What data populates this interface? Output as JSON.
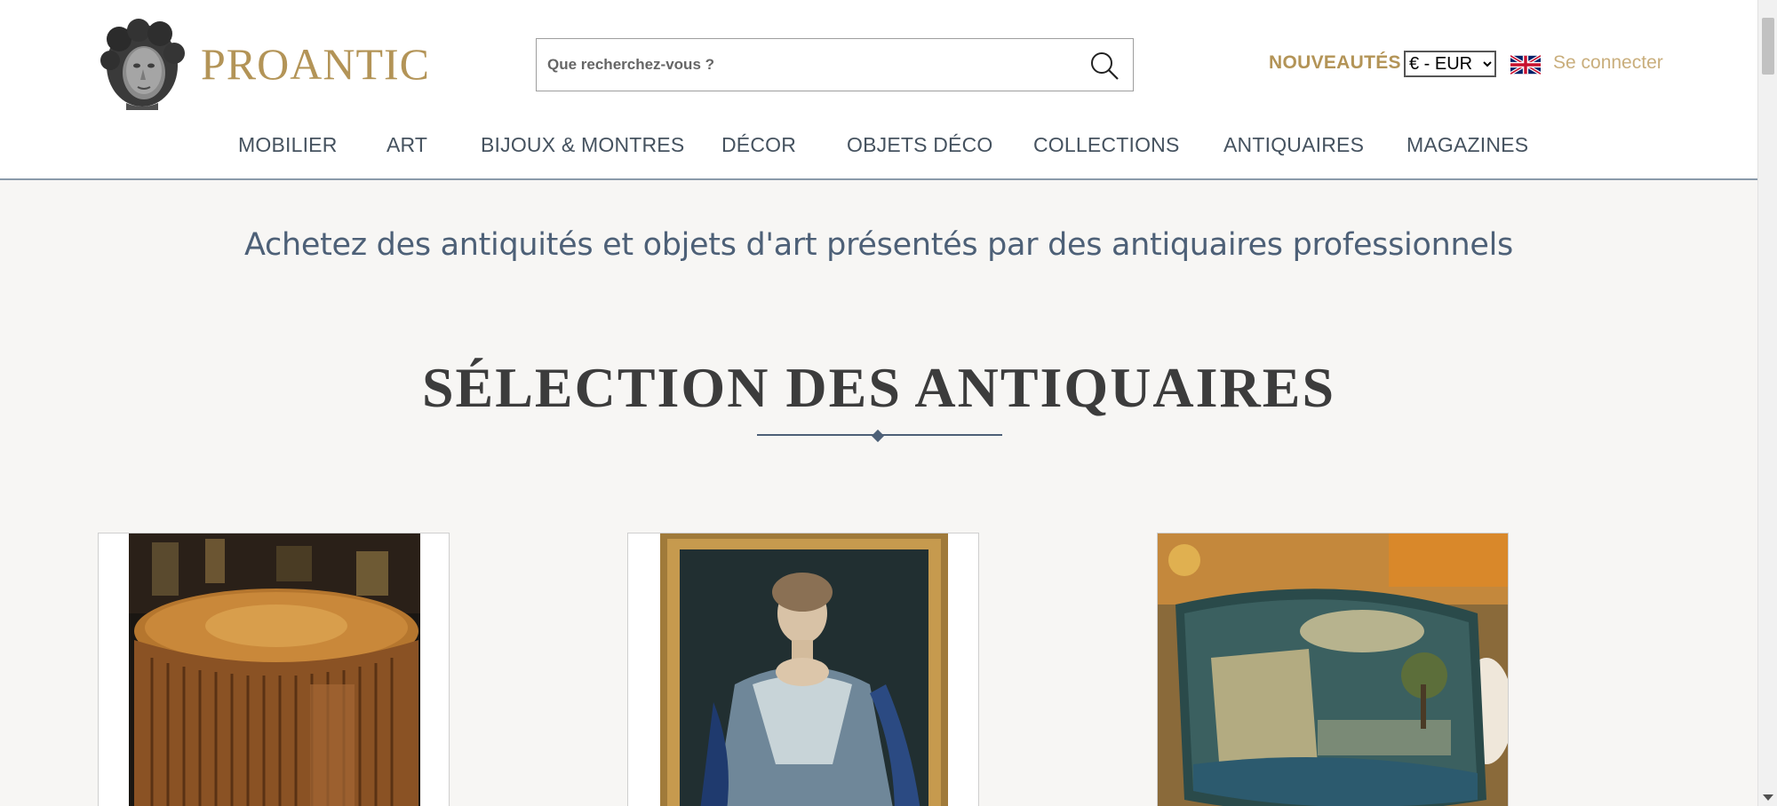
{
  "brand": {
    "name": "PROANTIC"
  },
  "search": {
    "placeholder": "Que recherchez-vous ?"
  },
  "header": {
    "news_label": "NOUVEAUTÉS",
    "currency_selected": "€ - EUR",
    "login_label": "Se connecter"
  },
  "nav": [
    "MOBILIER",
    "ART",
    "BIJOUX & MONTRES",
    "DÉCOR",
    "OBJETS DÉCO",
    "COLLECTIONS",
    "ANTIQUAIRES",
    "MAGAZINES"
  ],
  "hero": {
    "tagline": "Achetez des antiquités et objets d'art présentés par des antiquaires professionnels",
    "section_title": "SÉLECTION DES ANTIQUAIRES"
  },
  "colors": {
    "accent_gold": "#b39457",
    "slate": "#4d6077",
    "nav_text": "#45525f"
  },
  "icons": {
    "search": "magnifier-icon",
    "flag": "uk-flag-icon"
  }
}
